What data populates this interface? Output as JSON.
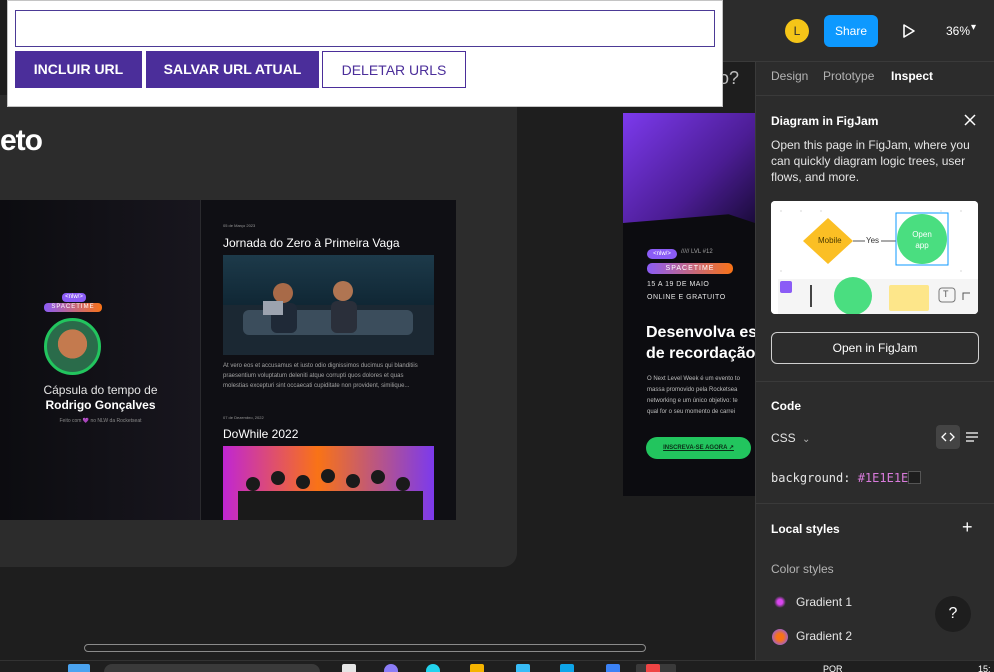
{
  "url_toolbar": {
    "input_value": "",
    "buttons": {
      "incluir": "INCLUIR URL",
      "salvar": "SALVAR URL ATUAL",
      "deletar": "DELETAR URLS"
    }
  },
  "canvas": {
    "frame_title_fragment": "eto",
    "ghost_title_fragment": "eto?",
    "site_left": {
      "nlw_badge": "<nlw/>",
      "spacetime_badge": "SPACETIME",
      "capsule_title": "Cápsula do tempo de",
      "capsule_name": "Rodrigo Gonçalves",
      "footer": "Feito com 💜 no NLW da Rocketseat"
    },
    "posts": [
      {
        "date": "05 de Março 2023",
        "title": "Jornada do Zero à Primeira Vaga",
        "desc": [
          "At vero eos et accusamus et iusto odio dignissimos ducimus qui blanditiis",
          "praesentium voluptatum deleniti atque corrupti quos dolores et quas",
          "molestias excepturi sint occaecati cupiditate non provident, similique..."
        ]
      },
      {
        "date": "07 de Dezembro, 2022",
        "title": "DoWhile 2022"
      }
    ],
    "frame2": {
      "nlw_badge": "<nlw/>",
      "lvl": "///// LVL #12",
      "spacetime": "SPACETIME",
      "dates": "15 A 19 DE MAIO",
      "online": "ONLINE E GRATUITO",
      "headline_1": "Desenvolva es",
      "headline_2": "de recordação",
      "paragraph": [
        "O Next Level Week é um evento to",
        "massa promovido pela Rocketsea",
        "networking e um único objetivo: te",
        "qual for o seu momento de carrei"
      ],
      "cta": "INSCREVA-SE AGORA ↗"
    }
  },
  "topbar": {
    "user_initial": "L",
    "share": "Share",
    "zoom": "36%",
    "zoom_chevron": "▾"
  },
  "inspector": {
    "tabs": [
      {
        "label": "Design"
      },
      {
        "label": "Prototype"
      },
      {
        "label": "Inspect"
      }
    ],
    "active_tab": "Inspect",
    "figjam": {
      "title": "Diagram in FigJam",
      "description": "Open this page in FigJam, where you can quickly diagram logic trees, user flows, and more.",
      "diagram": {
        "node1": "Mobile",
        "edge": "Yes",
        "node2": "Open app",
        "text_tool": "T"
      },
      "button": "Open in FigJam"
    },
    "code": {
      "title": "Code",
      "language": "CSS",
      "language_chevron": "⌄",
      "line_prop": "background: ",
      "line_value": "#1E1E1E",
      "line_end": ";"
    },
    "local_styles": {
      "title": "Local styles",
      "plus": "+",
      "color_styles_title": "Color styles",
      "styles": [
        {
          "name": "Gradient 1",
          "color_a": "#d946ef",
          "color_b": "#1e1e1e"
        },
        {
          "name": "Gradient 2",
          "color_a": "#f97316",
          "color_b": "#8b5cf6"
        }
      ]
    },
    "help": "?"
  },
  "taskbar": {
    "lang": "POR",
    "time": "15:"
  },
  "colors": {
    "accent_purple": "#4b2e9a",
    "figma_blue": "#0d99ff",
    "bg": "#1e1e1e",
    "panel": "#2c2c2c"
  }
}
